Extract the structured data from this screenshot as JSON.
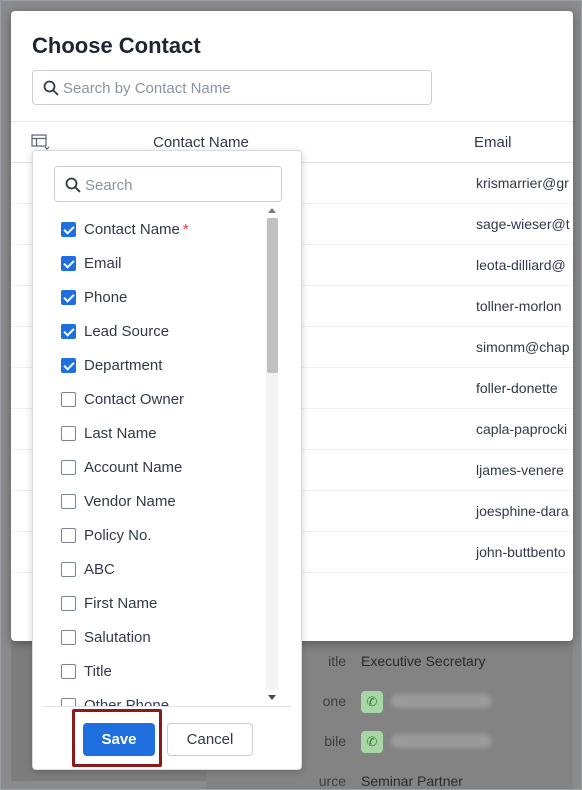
{
  "modal": {
    "title": "Choose Contact",
    "search_placeholder": "Search by Contact Name"
  },
  "table": {
    "columns": [
      "Contact Name",
      "Email"
    ],
    "emails": [
      "krismarrier@gr",
      "sage-wieser@t",
      "leota-dilliard@",
      "tollner-morlon",
      "simonm@chap",
      "foller-donette",
      "capla-paprocki",
      "ljames-venere",
      "joesphine-dara",
      "john-buttbento"
    ]
  },
  "column_chooser": {
    "search_placeholder": "Search",
    "fields": [
      {
        "label": "Contact Name",
        "checked": true,
        "required": true
      },
      {
        "label": "Email",
        "checked": true,
        "required": false
      },
      {
        "label": "Phone",
        "checked": true,
        "required": false
      },
      {
        "label": "Lead Source",
        "checked": true,
        "required": false
      },
      {
        "label": "Department",
        "checked": true,
        "required": false
      },
      {
        "label": "Contact Owner",
        "checked": false,
        "required": false
      },
      {
        "label": "Last Name",
        "checked": false,
        "required": false
      },
      {
        "label": "Account Name",
        "checked": false,
        "required": false
      },
      {
        "label": "Vendor Name",
        "checked": false,
        "required": false
      },
      {
        "label": "Policy No.",
        "checked": false,
        "required": false
      },
      {
        "label": "ABC",
        "checked": false,
        "required": false
      },
      {
        "label": "First Name",
        "checked": false,
        "required": false
      },
      {
        "label": "Salutation",
        "checked": false,
        "required": false
      },
      {
        "label": "Title",
        "checked": false,
        "required": false
      },
      {
        "label": "Other Phone",
        "checked": false,
        "required": false
      }
    ],
    "required_mark": "*",
    "save_label": "Save",
    "cancel_label": "Cancel"
  },
  "background_details": {
    "rows": [
      {
        "label": "itle",
        "value": "Executive Secretary"
      },
      {
        "label": "one",
        "value": ""
      },
      {
        "label": "bile",
        "value": ""
      },
      {
        "label": "urce",
        "value": "Seminar Partner"
      }
    ]
  },
  "colors": {
    "primary": "#1f6fde",
    "highlight_border": "#8b1a1a",
    "required": "#e0393e"
  }
}
